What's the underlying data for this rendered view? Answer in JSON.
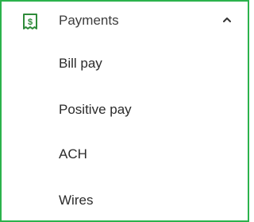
{
  "menu": {
    "section": {
      "label": "Payments",
      "icon": "receipt-dollar-icon",
      "expanded_indicator": "chevron-up-icon",
      "icon_color": "#2e8b3a"
    },
    "items": [
      {
        "label": "Bill pay"
      },
      {
        "label": "Positive pay"
      },
      {
        "label": "ACH"
      },
      {
        "label": "Wires"
      }
    ],
    "border_color": "#2bb24c"
  }
}
